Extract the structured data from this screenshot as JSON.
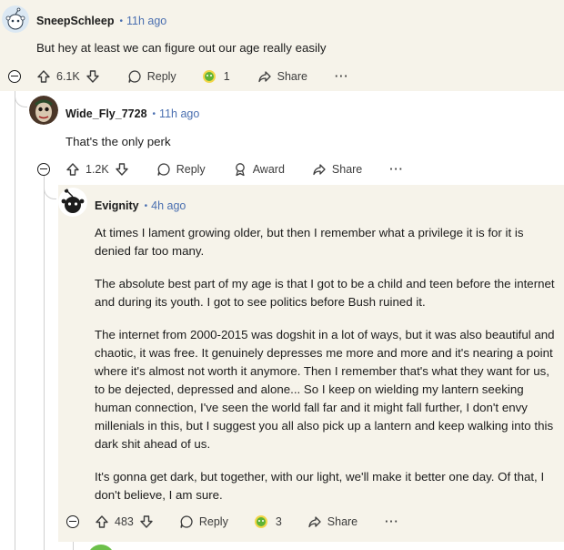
{
  "comments": [
    {
      "username": "SneepSchleep",
      "time": "11h ago",
      "body": [
        "But hey at least we can figure out our age really easily"
      ],
      "votes": "6.1K",
      "reply_label": "Reply",
      "award_count": "1",
      "share_label": "Share",
      "more_label": "···"
    },
    {
      "username": "Wide_Fly_7728",
      "time": "11h ago",
      "body": [
        "That's the only perk"
      ],
      "votes": "1.2K",
      "reply_label": "Reply",
      "award_label": "Award",
      "share_label": "Share",
      "more_label": "···"
    },
    {
      "username": "Evignity",
      "time": "4h ago",
      "body": [
        "At times I lament growing older, but then I remember what a privilege it is for it is denied far too many.",
        "The absolute best part of my age is that I got to be a child and teen before the internet and during its youth. I got to see politics before Bush ruined it.",
        "The internet from 2000-2015 was dogshit in a lot of ways, but it was also beautiful and chaotic, it was free. It genuinely depresses me more and more and it's nearing a point where it's almost not worth it anymore. Then I remember that's what they want for us, to be dejected, depressed and alone... So I keep on wielding my lantern seeking human connection, I've seen the world fall far and it might fall further, I don't envy millenials in this, but I suggest you all also pick up a lantern and keep walking into this dark shit ahead of us.",
        "It's gonna get dark, but together, with our light, we'll make it better one day. Of that, I don't believe, I am sure."
      ],
      "votes": "483",
      "reply_label": "Reply",
      "award_count": "3",
      "share_label": "Share",
      "more_label": "···"
    }
  ],
  "colors": {
    "highlight_bg": "#f6f3ea",
    "timestamp": "#4a6fb0",
    "thread_line": "#d0d0d0"
  },
  "icons": [
    "upvote-icon",
    "downvote-icon",
    "reply-icon",
    "award-icon",
    "share-icon",
    "more-icon",
    "collapse-icon"
  ]
}
